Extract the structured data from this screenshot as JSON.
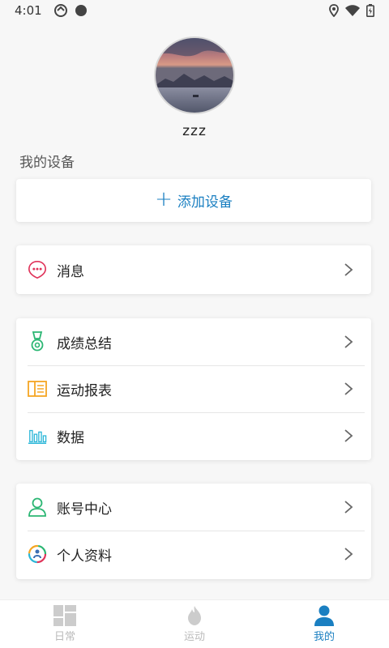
{
  "status_bar": {
    "time": "4:01"
  },
  "profile": {
    "username": "zzz"
  },
  "devices": {
    "section_label": "我的设备",
    "add_device_label": "添加设备"
  },
  "menu": {
    "messages": "消息",
    "group1": [
      "成绩总结",
      "运动报表",
      "数据"
    ],
    "group2": [
      "账号中心",
      "个人资料"
    ]
  },
  "bottom_nav": {
    "items": [
      "日常",
      "运动",
      "我的"
    ],
    "active": "我的"
  },
  "colors": {
    "accent": "#1a7fc1",
    "message_icon": "#e0345a",
    "medal_icon": "#2bb673",
    "report_icon": "#f5a623",
    "data_icon": "#29b6d8",
    "account_icon": "#2bb673"
  }
}
